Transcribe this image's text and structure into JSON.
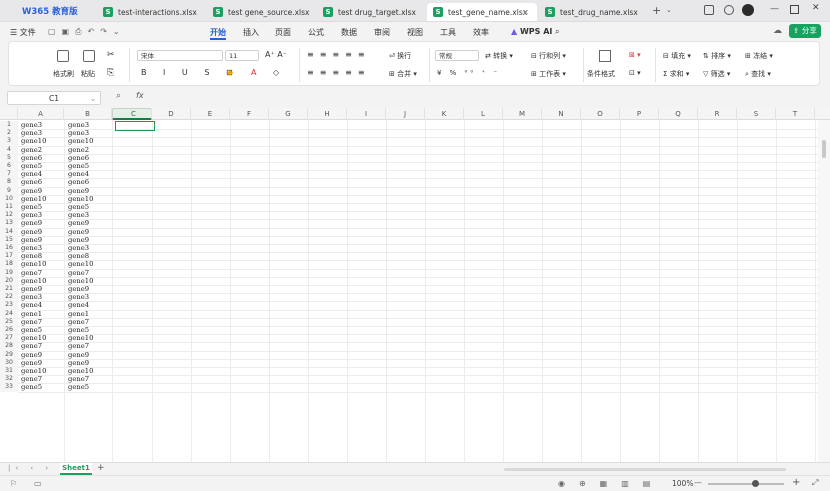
{
  "app": {
    "logo": "W365 教育版"
  },
  "tabs": [
    {
      "label": "test-interactions.xlsx"
    },
    {
      "label": "test gene_source.xlsx"
    },
    {
      "label": "test drug_target.xlsx"
    },
    {
      "label": "test_gene_name.xlsx"
    },
    {
      "label": "test_drug_name.xlsx"
    }
  ],
  "titlebar": {
    "share": "分享"
  },
  "menu": {
    "file": "文件",
    "items": [
      "开始",
      "插入",
      "页面",
      "公式",
      "数据",
      "审阅",
      "视图",
      "工具",
      "效率"
    ],
    "wps_ai": "WPS AI"
  },
  "ribbon": {
    "format_painter": "格式刷",
    "paste": "粘贴",
    "font_name": "宋体",
    "font_size": "11",
    "wrap": "换行",
    "merge": "合并",
    "number_format": "常规",
    "convert": "转换",
    "rows_cols": "行和列",
    "worksheet": "工作表",
    "cond_format": "条件格式",
    "fill": "填充",
    "sort": "排序",
    "freeze": "冻结",
    "sum": "求和",
    "filter": "筛选",
    "find": "查找"
  },
  "formula_bar": {
    "cell_ref": "C1",
    "fx": "fx",
    "value": ""
  },
  "columns": [
    "A",
    "B",
    "C",
    "D",
    "E",
    "F",
    "G",
    "H",
    "I",
    "J",
    "K",
    "L",
    "M",
    "N",
    "O",
    "P",
    "Q",
    "R",
    "S",
    "T"
  ],
  "rows": [
    [
      "gene3",
      "gene3"
    ],
    [
      "gene3",
      "gene3"
    ],
    [
      "gene10",
      "gene10"
    ],
    [
      "gene2",
      "gene2"
    ],
    [
      "gene6",
      "gene6"
    ],
    [
      "gene5",
      "gene5"
    ],
    [
      "gene4",
      "gene4"
    ],
    [
      "gene6",
      "gene6"
    ],
    [
      "gene9",
      "gene9"
    ],
    [
      "gene10",
      "gene10"
    ],
    [
      "gene5",
      "gene5"
    ],
    [
      "gene3",
      "gene3"
    ],
    [
      "gene9",
      "gene9"
    ],
    [
      "gene9",
      "gene9"
    ],
    [
      "gene9",
      "gene9"
    ],
    [
      "gene3",
      "gene3"
    ],
    [
      "gene8",
      "gene8"
    ],
    [
      "gene10",
      "gene10"
    ],
    [
      "gene7",
      "gene7"
    ],
    [
      "gene10",
      "gene10"
    ],
    [
      "gene9",
      "gene9"
    ],
    [
      "gene3",
      "gene3"
    ],
    [
      "gene4",
      "gene4"
    ],
    [
      "gene1",
      "gene1"
    ],
    [
      "gene7",
      "gene7"
    ],
    [
      "gene5",
      "gene5"
    ],
    [
      "gene10",
      "gene10"
    ],
    [
      "gene7",
      "gene7"
    ],
    [
      "gene9",
      "gene9"
    ],
    [
      "gene9",
      "gene9"
    ],
    [
      "gene10",
      "gene10"
    ],
    [
      "gene7",
      "gene7"
    ],
    [
      "gene5",
      "gene5"
    ]
  ],
  "sheet_tabs": [
    {
      "label": "Sheet1"
    }
  ],
  "status": {
    "zoom": "100%"
  }
}
